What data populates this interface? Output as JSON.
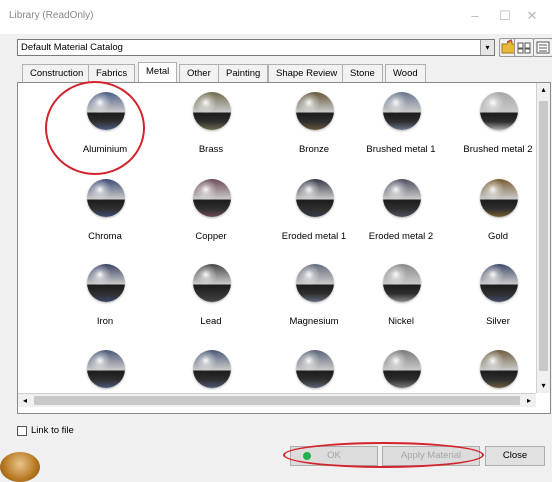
{
  "window": {
    "title": "Library (ReadOnly)",
    "minimize": "–",
    "maximize": "☐",
    "close": "✕"
  },
  "catalog": {
    "selected": "Default Material Catalog",
    "dropdown": "▾"
  },
  "tabs": [
    {
      "label": "Construction",
      "active": false
    },
    {
      "label": "Fabrics",
      "active": false
    },
    {
      "label": "Metal",
      "active": true
    },
    {
      "label": "Other",
      "active": false
    },
    {
      "label": "Painting",
      "active": false
    },
    {
      "label": "Shape Review",
      "active": false
    },
    {
      "label": "Stone",
      "active": false
    },
    {
      "label": "Wood",
      "active": false
    }
  ],
  "materials": [
    {
      "label": "Aluminium",
      "color": "#4b5f86"
    },
    {
      "label": "Brass",
      "color": "#6f6a4c"
    },
    {
      "label": "Bronze",
      "color": "#64573a"
    },
    {
      "label": "Brushed metal 1",
      "color": "#6a7690"
    },
    {
      "label": "Brushed metal 2",
      "color": "#a8a8a8"
    },
    {
      "label": "Chroma",
      "color": "#3c4c74"
    },
    {
      "label": "Copper",
      "color": "#6b4a58"
    },
    {
      "label": "Eroded metal 1",
      "color": "#343a46"
    },
    {
      "label": "Eroded metal 2",
      "color": "#4e5260"
    },
    {
      "label": "Gold",
      "color": "#785c31"
    },
    {
      "label": "Iron",
      "color": "#3a4464"
    },
    {
      "label": "Lead",
      "color": "#454545"
    },
    {
      "label": "Magnesium",
      "color": "#636c7e"
    },
    {
      "label": "Nickel",
      "color": "#8a8a8a"
    },
    {
      "label": "Silver",
      "color": "#3e4a68"
    },
    {
      "label": "",
      "color": "#4a5878"
    },
    {
      "label": "",
      "color": "#4a5876"
    },
    {
      "label": "",
      "color": "#5a6478"
    },
    {
      "label": "",
      "color": "#7a7a7a"
    },
    {
      "label": "",
      "color": "#6c5c3e"
    }
  ],
  "scroll": {
    "up": "▴",
    "down": "▾",
    "left": "◂",
    "right": "▸"
  },
  "link_to_file": {
    "label": "Link to file",
    "checked": false
  },
  "buttons": {
    "ok": "OK",
    "apply": "Apply Material",
    "close": "Close"
  },
  "colors": {
    "highlight_ring": "#d3232c",
    "ok_indicator": "#22b14c"
  }
}
